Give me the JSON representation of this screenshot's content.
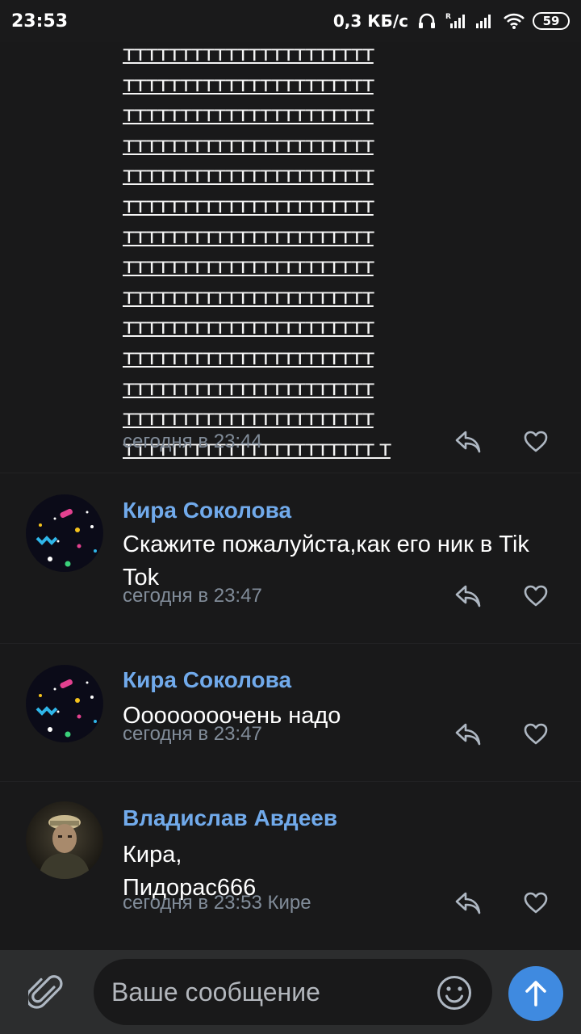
{
  "status_bar": {
    "time": "23:53",
    "net_speed": "0,3 КБ/с",
    "battery": "59"
  },
  "messages": [
    {
      "text_lines": [
        "тттттттттттттттттттттт",
        "тттттттттттттттттттттт",
        "тттттттттттттттттттттт",
        "тттттттттттттттттттттт",
        "тттттттттттттттттттттт",
        "тттттттттттттттттттттт",
        "тттттттттттттттттттттт",
        "тттттттттттттттттттттт",
        "тттттттттттттттттттттт",
        "тттттттттттттттттттттт",
        "тттттттттттттттттттттт",
        "тттттттттттттттттттттт",
        "тттттттттттттттттттттт",
        "тттттттттттттттттттттт т"
      ],
      "time": "сегодня в 23:44"
    },
    {
      "author": "Кира Соколова",
      "text": "Скажите пожалуйста,как его ник в Tik Tok",
      "time": "сегодня в 23:47"
    },
    {
      "author": "Кира Соколова",
      "text": "Оооооооочень надо",
      "time": "сегодня в 23:47"
    },
    {
      "author": "Владислав Авдеев",
      "text_lines": [
        "Кира,",
        "Пидорас666"
      ],
      "time": "сегодня в 23:53 Кире"
    }
  ],
  "composer": {
    "placeholder": "Ваше сообщение"
  },
  "icons": {
    "reply": "reply-icon",
    "like": "heart-icon",
    "attach": "paperclip-icon",
    "emoji": "smile-icon",
    "send": "arrow-up-icon"
  },
  "colors": {
    "background": "#19191a",
    "author": "#71aaeb",
    "meta": "#818c99",
    "send_button": "#3f8ae0",
    "composer_bar": "#2c2d2e"
  }
}
